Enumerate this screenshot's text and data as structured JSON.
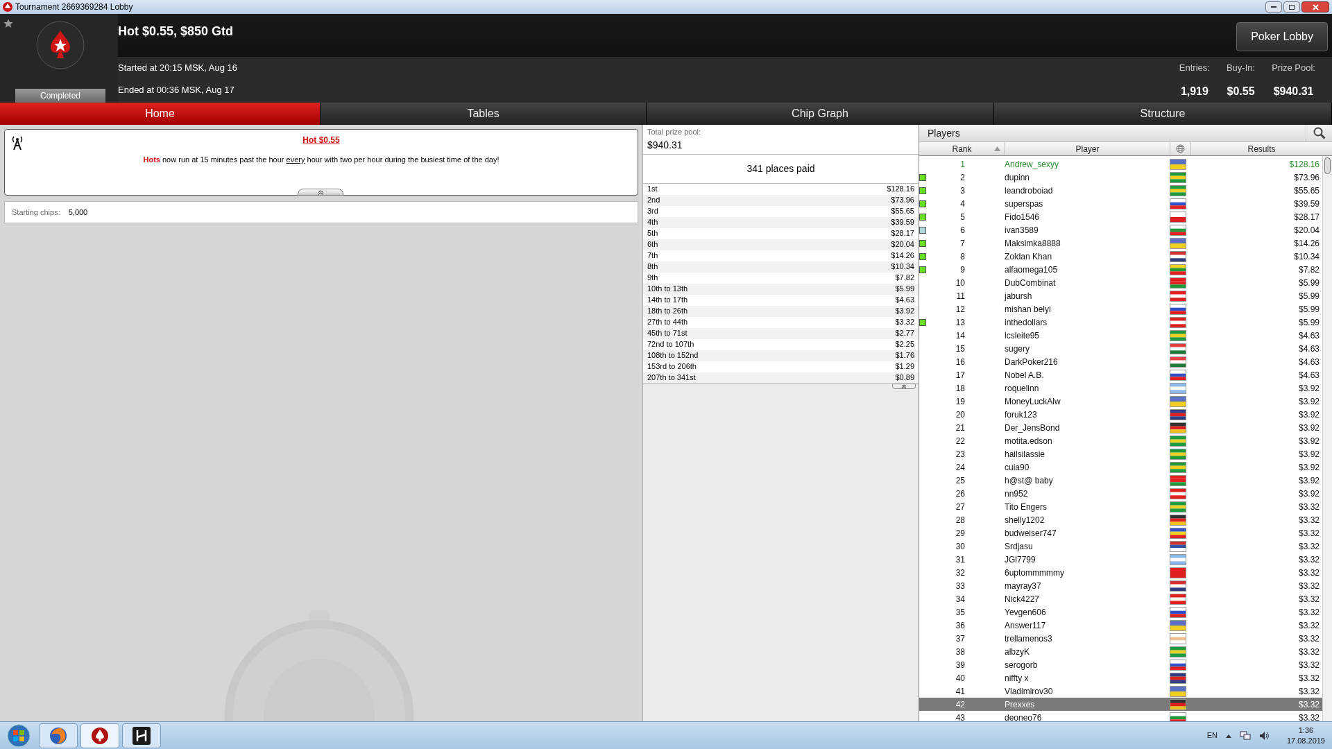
{
  "window": {
    "title": "Tournament 2669369284 Lobby"
  },
  "header": {
    "title": "Hot $0.55, $850 Gtd",
    "status": "Completed",
    "started": "Started at 20:15 MSK, Aug 16",
    "ended": "Ended at 00:36 MSK, Aug 17",
    "lobby_button": "Poker Lobby",
    "stats": [
      {
        "label": "Entries:",
        "value": "1,919"
      },
      {
        "label": "Buy-In:",
        "value": "$0.55"
      },
      {
        "label": "Prize Pool:",
        "value": "$940.31"
      }
    ]
  },
  "tabs": [
    {
      "label": "Home",
      "selected": true
    },
    {
      "label": "Tables",
      "selected": false
    },
    {
      "label": "Chip Graph",
      "selected": false
    },
    {
      "label": "Structure",
      "selected": false
    }
  ],
  "announcement": {
    "title": "Hot $0.55",
    "body": [
      {
        "text": "Hots",
        "kind": "strong"
      },
      {
        "text": " now run at 15 minutes past the hour ",
        "kind": "plain"
      },
      {
        "text": "every",
        "kind": "underline"
      },
      {
        "text": " hour with two per hour during the busiest time of the day!",
        "kind": "plain"
      }
    ]
  },
  "starting_chips": {
    "label": "Starting chips:",
    "value": "5,000"
  },
  "prizes": {
    "total_label": "Total prize pool:",
    "total": "$940.31",
    "places": "341 places paid",
    "rows": [
      {
        "place": "1st",
        "amount": "$128.16"
      },
      {
        "place": "2nd",
        "amount": "$73.96"
      },
      {
        "place": "3rd",
        "amount": "$55.65"
      },
      {
        "place": "4th",
        "amount": "$39.59"
      },
      {
        "place": "5th",
        "amount": "$28.17"
      },
      {
        "place": "6th",
        "amount": "$20.04"
      },
      {
        "place": "7th",
        "amount": "$14.26"
      },
      {
        "place": "8th",
        "amount": "$10.34"
      },
      {
        "place": "9th",
        "amount": "$7.82"
      },
      {
        "place": "10th to 13th",
        "amount": "$5.99"
      },
      {
        "place": "14th to 17th",
        "amount": "$4.63"
      },
      {
        "place": "18th to 26th",
        "amount": "$3.92"
      },
      {
        "place": "27th to 44th",
        "amount": "$3.32"
      },
      {
        "place": "45th to 71st",
        "amount": "$2.77"
      },
      {
        "place": "72nd to 107th",
        "amount": "$2.25"
      },
      {
        "place": "108th to 152nd",
        "amount": "$1.76"
      },
      {
        "place": "153rd to 206th",
        "amount": "$1.29"
      },
      {
        "place": "207th to 341st",
        "amount": "$0.89"
      }
    ]
  },
  "players": {
    "title": "Players",
    "columns": [
      "Rank",
      "Player",
      "Results"
    ],
    "rows": [
      {
        "rank": "1",
        "name": "Andrew_sexyy",
        "result": "$128.16",
        "winner": true,
        "selected": false,
        "flag": [
          {
            "color": "#5b6fc4"
          },
          {
            "color": "#f0d020"
          }
        ]
      },
      {
        "rank": "2",
        "name": "dupinn",
        "result": "$73.96",
        "winner": false,
        "selected": false,
        "color": "#66e020",
        "flag": [
          {
            "color": "#1f9a3a"
          },
          {
            "color": "#f0d020"
          },
          {
            "color": "#1f9a3a"
          }
        ]
      },
      {
        "rank": "3",
        "name": "leandroboiad",
        "result": "$55.65",
        "winner": false,
        "selected": false,
        "color": "#66e020",
        "flag": [
          {
            "color": "#1f9a3a"
          },
          {
            "color": "#f0d020"
          },
          {
            "color": "#1f9a3a"
          }
        ]
      },
      {
        "rank": "4",
        "name": "superspas",
        "result": "$39.59",
        "winner": false,
        "selected": false,
        "color": "#66e020",
        "flag": [
          {
            "color": "#ffffff"
          },
          {
            "color": "#3050c8"
          },
          {
            "color": "#e02020"
          }
        ]
      },
      {
        "rank": "5",
        "name": "Fido1546",
        "result": "$28.17",
        "winner": false,
        "selected": false,
        "color": "#66e020",
        "flag": [
          {
            "color": "#ffffff"
          },
          {
            "color": "#e02020"
          }
        ]
      },
      {
        "rank": "6",
        "name": "ivan3589",
        "result": "$20.04",
        "winner": false,
        "selected": false,
        "color": "#b0d8d8",
        "flag": [
          {
            "color": "#ffffff"
          },
          {
            "color": "#1f9a3a"
          },
          {
            "color": "#e02020"
          }
        ]
      },
      {
        "rank": "7",
        "name": "Maksimka8888",
        "result": "$14.26",
        "winner": false,
        "selected": false,
        "color": "#66e020",
        "flag": [
          {
            "color": "#5b6fc4"
          },
          {
            "color": "#f0d020"
          }
        ]
      },
      {
        "rank": "8",
        "name": "Zoldan Khan",
        "result": "$10.34",
        "winner": false,
        "selected": false,
        "color": "#66e020",
        "flag": [
          {
            "color": "#d03030"
          },
          {
            "color": "#ffffff"
          },
          {
            "color": "#303c80"
          }
        ]
      },
      {
        "rank": "9",
        "name": "alfaomega105",
        "result": "$7.82",
        "winner": false,
        "selected": false,
        "color": "#66e020",
        "flag": [
          {
            "color": "#f0d020"
          },
          {
            "color": "#1f9a3a"
          },
          {
            "color": "#e02020"
          }
        ]
      },
      {
        "rank": "10",
        "name": "DubCombinat",
        "result": "$5.99",
        "winner": false,
        "selected": false,
        "flag": [
          {
            "color": "#e02020"
          },
          {
            "color": "#e02020"
          },
          {
            "color": "#1f9a3a"
          }
        ]
      },
      {
        "rank": "11",
        "name": "jabursh",
        "result": "$5.99",
        "winner": false,
        "selected": false,
        "flag": [
          {
            "color": "#e02020"
          },
          {
            "color": "#ffffff"
          },
          {
            "color": "#e02020"
          }
        ]
      },
      {
        "rank": "12",
        "name": "mishan belyi",
        "result": "$5.99",
        "winner": false,
        "selected": false,
        "flag": [
          {
            "color": "#ffffff"
          },
          {
            "color": "#3050c8"
          },
          {
            "color": "#e02020"
          }
        ]
      },
      {
        "rank": "13",
        "name": "inthedollars",
        "result": "$5.99",
        "winner": false,
        "selected": false,
        "color": "#66e020",
        "flag": [
          {
            "color": "#e02020"
          },
          {
            "color": "#ffffff"
          },
          {
            "color": "#e02020"
          }
        ]
      },
      {
        "rank": "14",
        "name": "lcsleite95",
        "result": "$4.63",
        "winner": false,
        "selected": false,
        "flag": [
          {
            "color": "#1f9a3a"
          },
          {
            "color": "#f0d020"
          },
          {
            "color": "#1f9a3a"
          }
        ]
      },
      {
        "rank": "15",
        "name": "sugery",
        "result": "$4.63",
        "winner": false,
        "selected": false,
        "flag": [
          {
            "color": "#e04040"
          },
          {
            "color": "#ffffff"
          },
          {
            "color": "#1f7a3a"
          }
        ]
      },
      {
        "rank": "16",
        "name": "DarkPoker216",
        "result": "$4.63",
        "winner": false,
        "selected": false,
        "flag": [
          {
            "color": "#e04040"
          },
          {
            "color": "#ffffff"
          },
          {
            "color": "#1f7a3a"
          }
        ]
      },
      {
        "rank": "17",
        "name": "Nobel A.B.",
        "result": "$4.63",
        "winner": false,
        "selected": false,
        "flag": [
          {
            "color": "#ffffff"
          },
          {
            "color": "#3050c8"
          },
          {
            "color": "#e02020"
          }
        ]
      },
      {
        "rank": "18",
        "name": "roquelinn",
        "result": "$3.92",
        "winner": false,
        "selected": false,
        "flag": [
          {
            "color": "#8ab8e8"
          },
          {
            "color": "#ffffff"
          },
          {
            "color": "#8ab8e8"
          }
        ]
      },
      {
        "rank": "19",
        "name": "MoneyLuckAlw",
        "result": "$3.92",
        "winner": false,
        "selected": false,
        "flag": [
          {
            "color": "#5b6fc4"
          },
          {
            "color": "#f0d020"
          }
        ]
      },
      {
        "rank": "20",
        "name": "foruk123",
        "result": "$3.92",
        "winner": false,
        "selected": false,
        "flag": [
          {
            "color": "#303c80"
          },
          {
            "color": "#e02020"
          },
          {
            "color": "#303c80"
          }
        ]
      },
      {
        "rank": "21",
        "name": "Der_JensBond",
        "result": "$3.92",
        "winner": false,
        "selected": false,
        "flag": [
          {
            "color": "#303030"
          },
          {
            "color": "#e02020"
          },
          {
            "color": "#f0c020"
          }
        ]
      },
      {
        "rank": "22",
        "name": "motita.edson",
        "result": "$3.92",
        "winner": false,
        "selected": false,
        "flag": [
          {
            "color": "#1f9a3a"
          },
          {
            "color": "#f0d020"
          },
          {
            "color": "#1f9a3a"
          }
        ]
      },
      {
        "rank": "23",
        "name": "hailsilassie",
        "result": "$3.92",
        "winner": false,
        "selected": false,
        "flag": [
          {
            "color": "#1f9a3a"
          },
          {
            "color": "#f0d020"
          },
          {
            "color": "#1f9a3a"
          }
        ]
      },
      {
        "rank": "24",
        "name": "cuia90",
        "result": "$3.92",
        "winner": false,
        "selected": false,
        "flag": [
          {
            "color": "#1f9a3a"
          },
          {
            "color": "#f0d020"
          },
          {
            "color": "#1f9a3a"
          }
        ]
      },
      {
        "rank": "25",
        "name": "h@st@ baby",
        "result": "$3.92",
        "winner": false,
        "selected": false,
        "flag": [
          {
            "color": "#e02020"
          },
          {
            "color": "#e02020"
          },
          {
            "color": "#1f9a3a"
          }
        ]
      },
      {
        "rank": "26",
        "name": "nn952",
        "result": "$3.92",
        "winner": false,
        "selected": false,
        "flag": [
          {
            "color": "#e02020"
          },
          {
            "color": "#ffffff"
          },
          {
            "color": "#e02020"
          }
        ]
      },
      {
        "rank": "27",
        "name": "Tito Engers",
        "result": "$3.32",
        "winner": false,
        "selected": false,
        "flag": [
          {
            "color": "#1f9a3a"
          },
          {
            "color": "#f0d020"
          },
          {
            "color": "#1f9a3a"
          }
        ]
      },
      {
        "rank": "28",
        "name": "shelly1202",
        "result": "$3.32",
        "winner": false,
        "selected": false,
        "flag": [
          {
            "color": "#303030"
          },
          {
            "color": "#e02020"
          },
          {
            "color": "#f0c020"
          }
        ]
      },
      {
        "rank": "29",
        "name": "budweiser747",
        "result": "$3.32",
        "winner": false,
        "selected": false,
        "flag": [
          {
            "color": "#3050c8"
          },
          {
            "color": "#f0d020"
          },
          {
            "color": "#e02020"
          }
        ]
      },
      {
        "rank": "30",
        "name": "Srdjasu",
        "result": "$3.32",
        "winner": false,
        "selected": false,
        "flag": [
          {
            "color": "#d03030"
          },
          {
            "color": "#3050a0"
          },
          {
            "color": "#ffffff"
          }
        ]
      },
      {
        "rank": "31",
        "name": "JGl7799",
        "result": "$3.32",
        "winner": false,
        "selected": false,
        "flag": [
          {
            "color": "#8ab8e8"
          },
          {
            "color": "#ffffff"
          },
          {
            "color": "#8ab8e8"
          }
        ]
      },
      {
        "rank": "32",
        "name": "6uptommmmmy",
        "result": "$3.32",
        "winner": false,
        "selected": false,
        "flag": [
          {
            "color": "#e02020"
          },
          {
            "color": "#e02020"
          }
        ]
      },
      {
        "rank": "33",
        "name": "mayray37",
        "result": "$3.32",
        "winner": false,
        "selected": false,
        "flag": [
          {
            "color": "#d03030"
          },
          {
            "color": "#ffffff"
          },
          {
            "color": "#303c80"
          }
        ]
      },
      {
        "rank": "34",
        "name": "Nick4227",
        "result": "$3.32",
        "winner": false,
        "selected": false,
        "flag": [
          {
            "color": "#e02020"
          },
          {
            "color": "#ffffff"
          },
          {
            "color": "#e02020"
          }
        ]
      },
      {
        "rank": "35",
        "name": "Yevgen606",
        "result": "$3.32",
        "winner": false,
        "selected": false,
        "flag": [
          {
            "color": "#ffffff"
          },
          {
            "color": "#3050c8"
          },
          {
            "color": "#e02020"
          }
        ]
      },
      {
        "rank": "36",
        "name": "Answer117",
        "result": "$3.32",
        "winner": false,
        "selected": false,
        "flag": [
          {
            "color": "#5b6fc4"
          },
          {
            "color": "#f0d020"
          }
        ]
      },
      {
        "rank": "37",
        "name": "trellamenos3",
        "result": "$3.32",
        "winner": false,
        "selected": false,
        "flag": [
          {
            "color": "#ffffff"
          },
          {
            "color": "#f0c090"
          },
          {
            "color": "#ffffff"
          }
        ]
      },
      {
        "rank": "38",
        "name": "albzyK",
        "result": "$3.32",
        "winner": false,
        "selected": false,
        "flag": [
          {
            "color": "#1f9a3a"
          },
          {
            "color": "#f0d020"
          },
          {
            "color": "#1f9a3a"
          }
        ]
      },
      {
        "rank": "39",
        "name": "serogorb",
        "result": "$3.32",
        "winner": false,
        "selected": false,
        "flag": [
          {
            "color": "#ffffff"
          },
          {
            "color": "#3050c8"
          },
          {
            "color": "#e02020"
          }
        ]
      },
      {
        "rank": "40",
        "name": "niffty x",
        "result": "$3.32",
        "winner": false,
        "selected": false,
        "flag": [
          {
            "color": "#303c80"
          },
          {
            "color": "#e02020"
          },
          {
            "color": "#303c80"
          }
        ]
      },
      {
        "rank": "41",
        "name": "Vladimirov30",
        "result": "$3.32",
        "winner": false,
        "selected": false,
        "flag": [
          {
            "color": "#5b6fc4"
          },
          {
            "color": "#f0d020"
          }
        ]
      },
      {
        "rank": "42",
        "name": "Prexxes",
        "result": "$3.32",
        "winner": false,
        "selected": true,
        "flag": [
          {
            "color": "#303030"
          },
          {
            "color": "#e02020"
          },
          {
            "color": "#f0c020"
          }
        ]
      },
      {
        "rank": "43",
        "name": "deoneo76",
        "result": "$3.32",
        "winner": false,
        "selected": false,
        "flag": [
          {
            "color": "#ffffff"
          },
          {
            "color": "#1f9a3a"
          },
          {
            "color": "#e02020"
          }
        ]
      }
    ]
  },
  "taskbar": {
    "language": "EN",
    "time": "1:36",
    "date": "17.08.2019"
  }
}
